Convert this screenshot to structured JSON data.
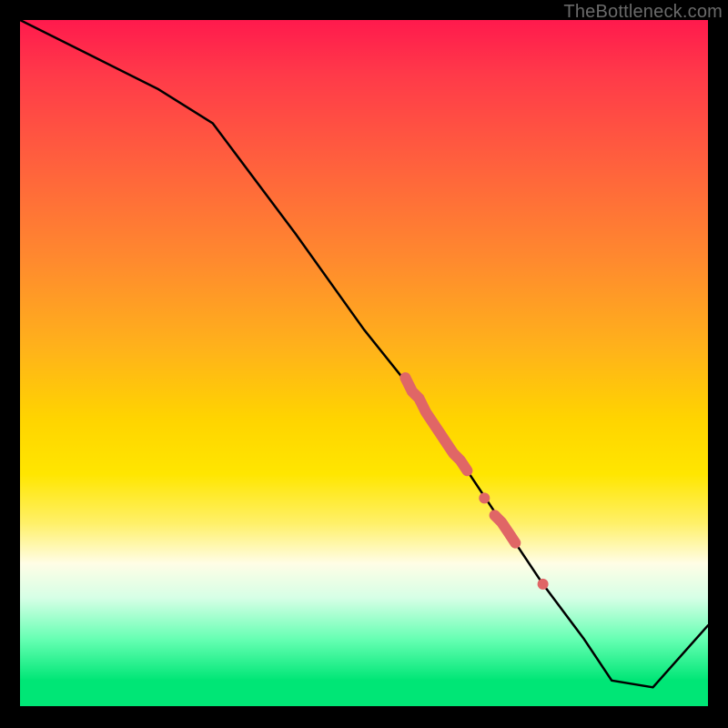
{
  "watermark": "TheBottleneck.com",
  "colors": {
    "gradient_top": "#ff1a4d",
    "gradient_mid": "#ffd400",
    "gradient_bottom": "#00e676",
    "line": "#000000",
    "marker": "#e06666",
    "frame": "#000000"
  },
  "chart_data": {
    "type": "line",
    "title": "",
    "xlabel": "",
    "ylabel": "",
    "xlim": [
      0,
      100
    ],
    "ylim": [
      0,
      100
    ],
    "grid": false,
    "legend": false,
    "series": [
      {
        "name": "bottleneck-curve",
        "x": [
          0,
          10,
          20,
          28,
          40,
          50,
          58,
          64,
          70,
          76,
          82,
          86,
          92,
          100
        ],
        "y": [
          100,
          95,
          90,
          85,
          69,
          55,
          45,
          36,
          27,
          18,
          10,
          4,
          3,
          12
        ]
      }
    ],
    "markers": [
      {
        "name": "highlight-segment-1",
        "style": "thick",
        "x": [
          56,
          57,
          58,
          59,
          60,
          61,
          62,
          63,
          64,
          65
        ],
        "y": [
          48,
          46,
          45,
          43,
          41.5,
          40,
          38.5,
          37,
          36,
          34.5
        ]
      },
      {
        "name": "highlight-dot-1",
        "style": "dot",
        "x": [
          67.5
        ],
        "y": [
          30.5
        ]
      },
      {
        "name": "highlight-segment-2",
        "style": "thick",
        "x": [
          69,
          70,
          71,
          72
        ],
        "y": [
          28,
          27,
          25.5,
          24
        ]
      },
      {
        "name": "highlight-dot-2",
        "style": "dot",
        "x": [
          76
        ],
        "y": [
          18
        ]
      }
    ]
  }
}
